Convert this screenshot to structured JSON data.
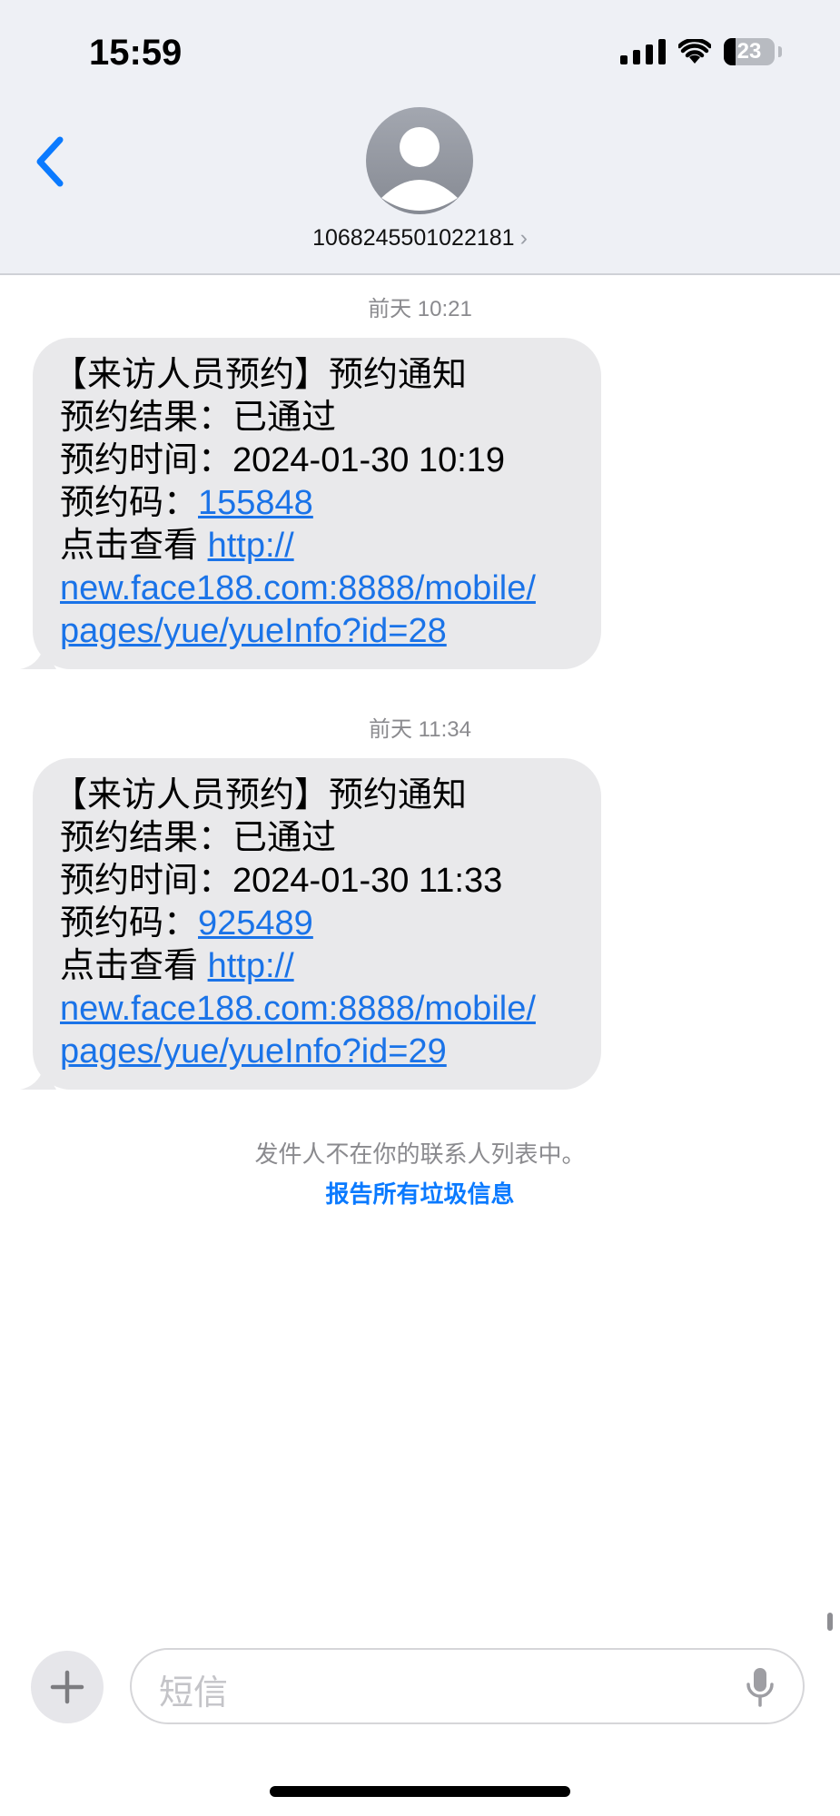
{
  "status_bar": {
    "time": "15:59",
    "battery": "23"
  },
  "header": {
    "contact_number": "1068245501022181",
    "chevron": "›"
  },
  "messages": [
    {
      "timestamp": "前天 10:21",
      "line1": "【来访人员预约】预约通知",
      "line2": "预约结果：已通过",
      "line3": "预约时间：2024-01-30 10:19",
      "code_label": "预约码：",
      "code": "155848",
      "view_label": "点击查看",
      "link_part1": "http://",
      "link_part2": "new.face188.com:8888/mobile/",
      "link_part3": "pages/yue/yueInfo?id=28"
    },
    {
      "timestamp": "前天 11:34",
      "line1": "【来访人员预约】预约通知",
      "line2": "预约结果：已通过",
      "line3": "预约时间：2024-01-30 11:33",
      "code_label": "预约码：",
      "code": "925489",
      "view_label": "点击查看",
      "link_part1": "http://",
      "link_part2": "new.face188.com:8888/mobile/",
      "link_part3": "pages/yue/yueInfo?id=29"
    }
  ],
  "notice": "发件人不在你的联系人列表中。",
  "report_link": "报告所有垃圾信息",
  "composer": {
    "placeholder": "短信",
    "plus_icon": "plus-icon",
    "mic_icon": "mic-icon"
  },
  "colors": {
    "accent": "#0a7aff",
    "link": "#1a73e8",
    "bubble": "#e9e9eb"
  }
}
